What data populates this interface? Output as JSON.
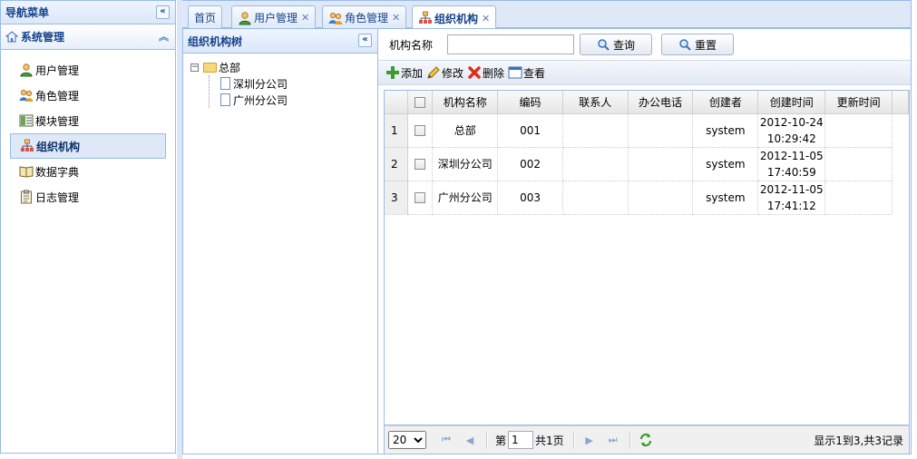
{
  "nav": {
    "title": "导航菜单",
    "section": "系统管理",
    "items": [
      {
        "label": "用户管理"
      },
      {
        "label": "角色管理"
      },
      {
        "label": "模块管理"
      },
      {
        "label": "组织机构"
      },
      {
        "label": "数据字典"
      },
      {
        "label": "日志管理"
      }
    ]
  },
  "tabs": [
    {
      "label": "首页"
    },
    {
      "label": "用户管理"
    },
    {
      "label": "角色管理"
    },
    {
      "label": "组织机构"
    }
  ],
  "tree": {
    "title": "组织机构树",
    "root": "总部",
    "children": [
      "深圳分公司",
      "广州分公司"
    ]
  },
  "search": {
    "label": "机构名称",
    "value": "",
    "query_btn": "查询",
    "reset_btn": "重置"
  },
  "toolbar": {
    "add": "添加",
    "edit": "修改",
    "delete": "删除",
    "view": "查看"
  },
  "grid": {
    "columns": [
      "机构名称",
      "编码",
      "联系人",
      "办公电话",
      "创建者",
      "创建时间",
      "更新时间"
    ],
    "rows": [
      {
        "n": "1",
        "name": "总部",
        "code": "001",
        "contact": "",
        "phone": "",
        "creator": "system",
        "created_date": "2012-10-24",
        "created_time": "10:29:42",
        "updated": ""
      },
      {
        "n": "2",
        "name": "深圳分公司",
        "code": "002",
        "contact": "",
        "phone": "",
        "creator": "system",
        "created_date": "2012-11-05",
        "created_time": "17:40:59",
        "updated": ""
      },
      {
        "n": "3",
        "name": "广州分公司",
        "code": "003",
        "contact": "",
        "phone": "",
        "creator": "system",
        "created_date": "2012-11-05",
        "created_time": "17:41:12",
        "updated": ""
      }
    ]
  },
  "pager": {
    "page_size": "20",
    "page_prefix": "第",
    "page_value": "1",
    "page_total": "共1页",
    "info": "显示1到3,共3记录"
  }
}
